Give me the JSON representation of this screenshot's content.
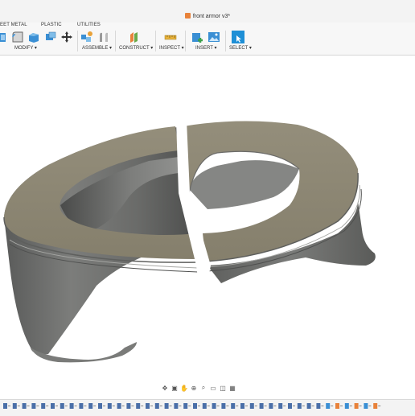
{
  "window": {
    "title": "front armor v3*"
  },
  "ribbon": {
    "tabs": [
      "EET METAL",
      "PLASTIC",
      "UTILITIES"
    ],
    "groups": {
      "modify": "MODIFY ▾",
      "assemble": "ASSEMBLE ▾",
      "construct": "CONSTRUCT ▾",
      "inspect": "INSPECT ▾",
      "insert": "INSERT ▾",
      "select": "SELECT ▾"
    }
  },
  "colors": {
    "accent": "#1e8fd6",
    "part_face": "#8a8572",
    "part_side": "#6a6b6a",
    "doc_icon": "#e8823a"
  },
  "nav_icons": [
    "orbit-icon",
    "look-at-icon",
    "pan-icon",
    "zoom-icon",
    "zoom-window-icon",
    "display-settings-icon",
    "visual-style-icon",
    "grid-icon"
  ],
  "timeline": {
    "feature_count": 40
  }
}
